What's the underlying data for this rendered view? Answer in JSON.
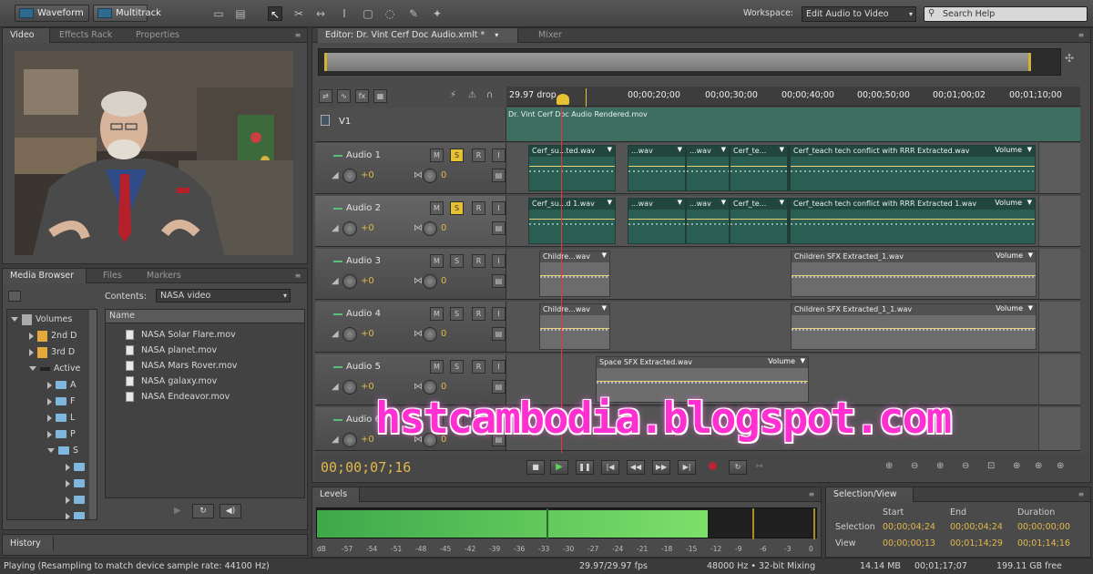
{
  "toolbar": {
    "waveform_label": "Waveform",
    "multitrack_label": "Multitrack",
    "workspace_label": "Workspace:",
    "workspace_value": "Edit Audio to Video",
    "search_placeholder": "Search Help"
  },
  "left_top_tabs": [
    "Video",
    "Effects Rack",
    "Properties"
  ],
  "media_tabs": [
    "Media Browser",
    "Files",
    "Markers"
  ],
  "media_browser": {
    "contents_label": "Contents:",
    "contents_value": "NASA video",
    "column_header": "Name",
    "tree": [
      "Volumes",
      "2nd D",
      "3rd D",
      "Active",
      "A",
      "F",
      "L",
      "P",
      "S"
    ],
    "files": [
      "NASA Solar Flare.mov",
      "NASA planet.mov",
      "NASA Mars Rover.mov",
      "NASA galaxy.mov",
      "NASA Endeavor.mov"
    ]
  },
  "history_tab": "History",
  "editor": {
    "tab_label": "Editor: Dr. Vint Cerf Doc Audio.xmlt *",
    "mixer_tab": "Mixer",
    "frame_rate_label": "29.97 drop",
    "ruler": [
      "00;00;20;00",
      "00;00;30;00",
      "00;00;40;00",
      "00;00;50;00",
      "00;01;00;02",
      "00;01;10;00"
    ],
    "video_track": {
      "name": "V1",
      "clip": "Dr. Vint Cerf Doc Audio Rendered.mov"
    },
    "tracks": [
      {
        "name": "Audio 1",
        "vol": "+0",
        "pan": "0",
        "clips": [
          "Cerf_su...ted.wav",
          "...wav",
          "...wav",
          "Cerf_te...",
          "Cerf_te...",
          "Cerf_teach tech conflict with RRR Extracted.wav",
          "Volume"
        ]
      },
      {
        "name": "Audio 2",
        "vol": "+0",
        "pan": "0",
        "clips": [
          "Cerf_su...d 1.wav",
          "...wav",
          "...wav",
          "Cerf_te...",
          "Cerf_te...",
          "Cerf_teach tech conflict with RRR Extracted 1.wav",
          "Volume"
        ]
      },
      {
        "name": "Audio 3",
        "vol": "+0",
        "pan": "0",
        "clips": [
          "Childre...wav",
          "Children SFX Extracted_1.wav",
          "Volume"
        ]
      },
      {
        "name": "Audio 4",
        "vol": "+0",
        "pan": "0",
        "clips": [
          "Childre...wav",
          "Children SFX Extracted_1_1.wav",
          "Volume"
        ]
      },
      {
        "name": "Audio 5",
        "vol": "+0",
        "pan": "0",
        "clips": [
          "Space SFX Extracted.wav",
          "Volume"
        ]
      },
      {
        "name": "Audio 6",
        "vol": "+0",
        "pan": "0",
        "clips": []
      }
    ],
    "timecode": "00;00;07;16"
  },
  "levels": {
    "tab": "Levels",
    "scale": [
      "dB",
      "-57",
      "-54",
      "-51",
      "-48",
      "-45",
      "-42",
      "-39",
      "-36",
      "-33",
      "-30",
      "-27",
      "-24",
      "-21",
      "-18",
      "-15",
      "-12",
      "-9",
      "-6",
      "-3",
      "0"
    ],
    "level_fraction": 0.78
  },
  "selection_view": {
    "tab": "Selection/View",
    "headers": [
      "Start",
      "End",
      "Duration"
    ],
    "rows": [
      {
        "label": "Selection",
        "start": "00;00;04;24",
        "end": "00;00;04;24",
        "duration": "00;00;00;00"
      },
      {
        "label": "View",
        "start": "00;00;00;13",
        "end": "00;01;14;29",
        "duration": "00;01;14;16"
      }
    ]
  },
  "status": {
    "left": "Playing (Resampling to match device sample rate: 44100 Hz)",
    "fps": "29.97/29.97 fps",
    "format": "48000 Hz • 32-bit Mixing",
    "size": "14.14 MB",
    "duration": "00;01;17;07",
    "free": "199.11 GB free"
  },
  "watermark": "hstcambodia.blogspot.com",
  "colors": {
    "accent_yellow": "#e2b84a",
    "clip_green": "#2b5e52",
    "meter_green": "#58d45a",
    "watermark": "#ff2fd1"
  }
}
